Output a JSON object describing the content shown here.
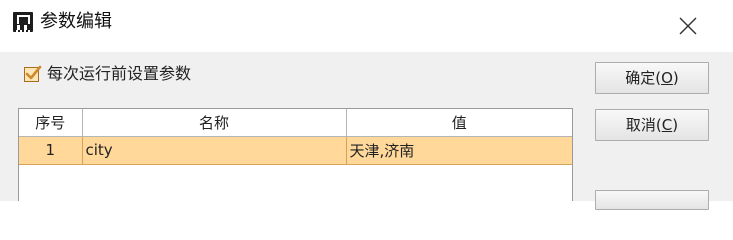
{
  "window": {
    "title": "参数编辑",
    "icon": "report-app-icon",
    "close_glyph": "✕"
  },
  "options": {
    "checkbox_label": "每次运行前设置参数",
    "checkbox_checked": true
  },
  "grid": {
    "columns": [
      "序号",
      "名称",
      "值"
    ],
    "rows": [
      {
        "index": "1",
        "name": "city",
        "value": "天津,济南"
      }
    ]
  },
  "buttons": {
    "ok": {
      "label": "确定(",
      "mnemonic": "O",
      "tail": ")"
    },
    "cancel": {
      "label": "取消(",
      "mnemonic": "C",
      "tail": ")"
    }
  },
  "colors": {
    "selected_row": "#ffd89a",
    "checkbox_check": "#d0892b",
    "dialog_bg": "#f0f0f0"
  }
}
